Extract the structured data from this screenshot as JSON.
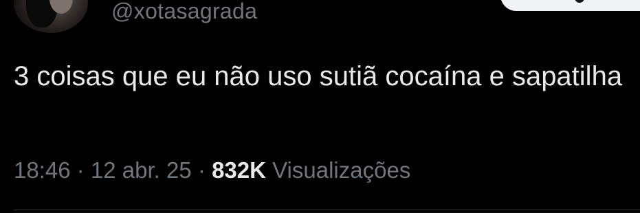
{
  "tweet": {
    "handle": "@xotasagrada",
    "text": "3 coisas que eu não uso sutiã cocaína e sapatilha",
    "time": "18:46",
    "date": "12 abr. 25",
    "separator": "·",
    "views_count": "832K",
    "views_label": "Visualizações"
  },
  "colors": {
    "background": "#000000",
    "primary_text": "#e7e9ea",
    "secondary_text": "#71767b",
    "button_bg": "#eff3f4"
  }
}
